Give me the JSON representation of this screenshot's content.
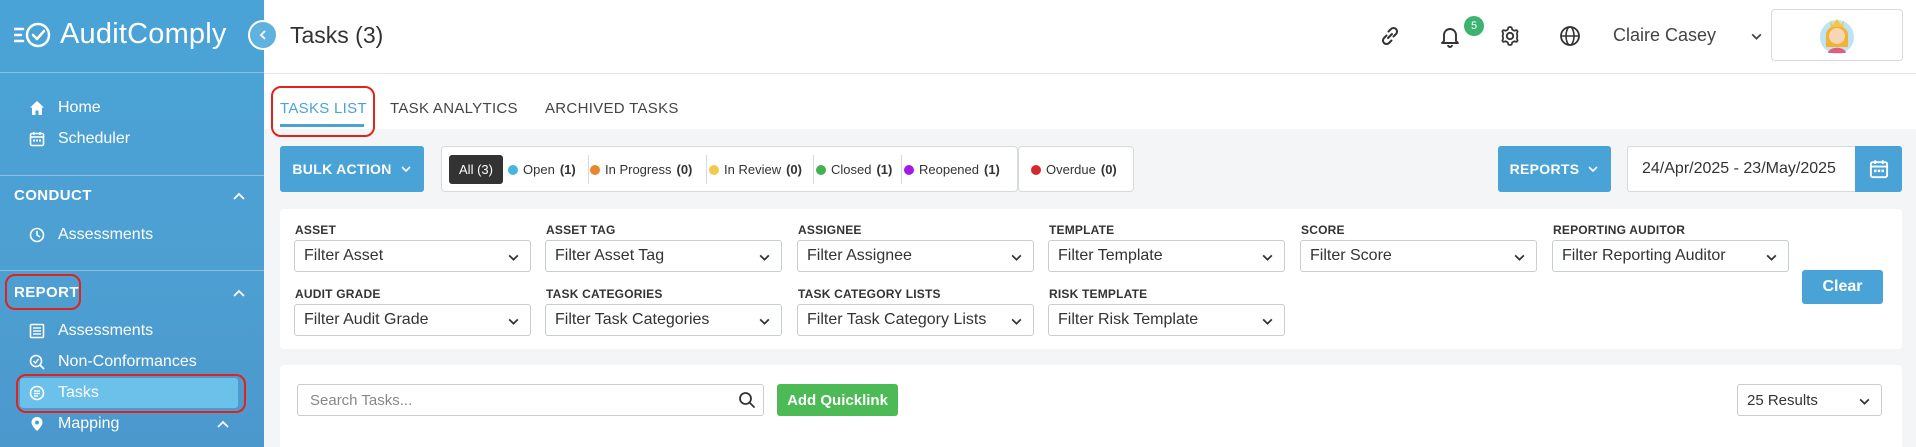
{
  "app": {
    "name": "AuditComply",
    "accent": "#4aa3d6"
  },
  "sidebar": {
    "top_items": [
      {
        "label": "Home",
        "icon": "home-icon"
      },
      {
        "label": "Scheduler",
        "icon": "calendar-icon"
      }
    ],
    "conduct": {
      "title": "CONDUCT",
      "items": [
        {
          "label": "Assessments",
          "icon": "clock-icon"
        }
      ]
    },
    "report": {
      "title": "REPORT",
      "items": [
        {
          "label": "Assessments",
          "icon": "list-icon"
        },
        {
          "label": "Non-Conformances",
          "icon": "search-check-icon"
        },
        {
          "label": "Tasks",
          "icon": "tasks-icon",
          "active": true
        },
        {
          "label": "Mapping",
          "icon": "map-pin-icon"
        }
      ]
    }
  },
  "header": {
    "title": "Tasks (3)",
    "notifications_count": "5",
    "user_name": "Claire Casey"
  },
  "tabs": [
    {
      "label": "TASKS LIST",
      "active": true
    },
    {
      "label": "TASK ANALYTICS"
    },
    {
      "label": "ARCHIVED TASKS"
    }
  ],
  "toolbar": {
    "bulk_action": "BULK ACTION",
    "all_label": "All (3)",
    "statuses": [
      {
        "name": "Open",
        "count": "(1)",
        "color": "#45b6e0"
      },
      {
        "name": "In Progress",
        "count": "(0)",
        "color": "#e8862b"
      },
      {
        "name": "In Review",
        "count": "(0)",
        "color": "#f2c94c"
      },
      {
        "name": "Closed",
        "count": "(1)",
        "color": "#43b14f"
      },
      {
        "name": "Reopened",
        "count": "(1)",
        "color": "#a31ae0"
      }
    ],
    "overdue": {
      "name": "Overdue",
      "count": "(0)",
      "color": "#d7282f"
    },
    "reports": "REPORTS",
    "date_range": "24/Apr/2025 - 23/May/2025"
  },
  "filters": {
    "row1": [
      {
        "label": "ASSET",
        "placeholder": "Filter Asset"
      },
      {
        "label": "ASSET TAG",
        "placeholder": "Filter Asset Tag"
      },
      {
        "label": "ASSIGNEE",
        "placeholder": "Filter Assignee"
      },
      {
        "label": "TEMPLATE",
        "placeholder": "Filter Template"
      },
      {
        "label": "SCORE",
        "placeholder": "Filter Score"
      },
      {
        "label": "REPORTING AUDITOR",
        "placeholder": "Filter Reporting Auditor"
      }
    ],
    "row2": [
      {
        "label": "AUDIT GRADE",
        "placeholder": "Filter Audit Grade"
      },
      {
        "label": "TASK CATEGORIES",
        "placeholder": "Filter Task Categories"
      },
      {
        "label": "TASK CATEGORY LISTS",
        "placeholder": "Filter Task Category Lists"
      },
      {
        "label": "RISK TEMPLATE",
        "placeholder": "Filter Risk Template"
      }
    ],
    "clear": "Clear"
  },
  "search": {
    "placeholder": "Search Tasks...",
    "quicklink": "Add Quicklink",
    "results": "25 Results"
  }
}
